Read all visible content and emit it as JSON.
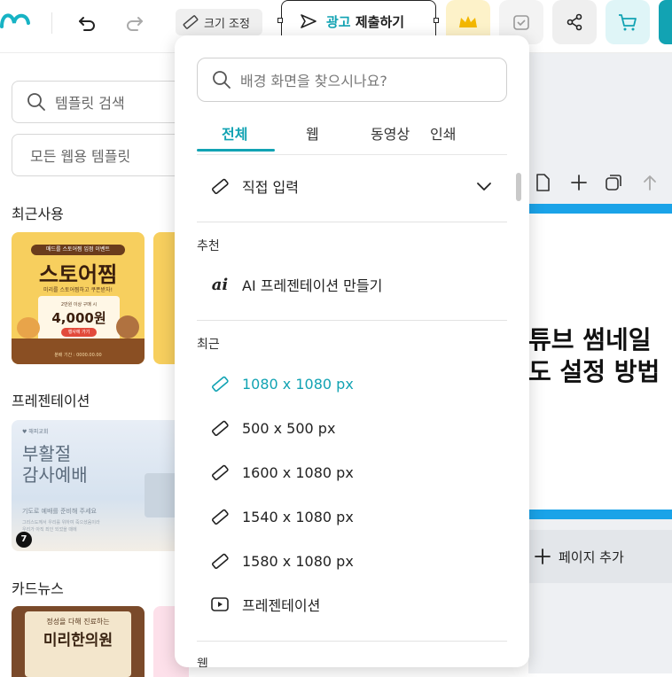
{
  "topbar": {
    "resize_label": "크기 조정",
    "ad_label_accent": "광고",
    "ad_label_rest": "제출하기"
  },
  "sidebar": {
    "search_placeholder": "템플릿 검색",
    "filter_value": "모든 웹용 템플릿",
    "recent_heading": "최근사용",
    "presentation_heading": "프레젠테이션",
    "cardnews_heading": "카드뉴스",
    "thumb_store": {
      "banner": "매드를 스토어찜 입점 이벤트",
      "title": "스토어찜",
      "sub": "미리를 스토어찜하고 쿠폰받자!",
      "note": "2만원 이상 구매 시",
      "price": "4,000원",
      "btn": "행사에 가기",
      "foot": "분배 기간 : 0000.00.00"
    },
    "thumb_easter": {
      "logo": "♥ 해피교회",
      "title1": "부활절",
      "title2": "감사예배",
      "sub": "기도로 예배를 준비해 주세요",
      "fine1": "그리스도께서 우리를 위하여 죽으셨음이라",
      "fine2": "우리가 아직 죄인 되었을 때에",
      "badge": "7"
    },
    "thumb_clinic": {
      "line1": "정성을 다해 진료하는",
      "title": "미리한의원"
    }
  },
  "dropdown": {
    "search_placeholder": "배경 화면을 찾으시나요?",
    "tabs": [
      "전체",
      "웹",
      "동영상",
      "인쇄"
    ],
    "custom_input": "직접 입력",
    "recommended_label": "추천",
    "ai_item": "AI 프레젠테이션 만들기",
    "recent_label": "최근",
    "recent_items": [
      "1080 x 1080 px",
      "500 x 500 px",
      "1600 x 1080 px",
      "1540 x 1080 px",
      "1580 x 1080 px"
    ],
    "presentation_item": "프레젠테이션",
    "web_label": "웹"
  },
  "canvas": {
    "title_line1": "튜브 썸네일",
    "title_line2": "도 설정 방법",
    "add_page": "페이지 추가"
  },
  "colors": {
    "accent": "#12a3b3",
    "canvas_stripe": "#1aa3e8",
    "crown_bg": "#fdf2c9"
  }
}
